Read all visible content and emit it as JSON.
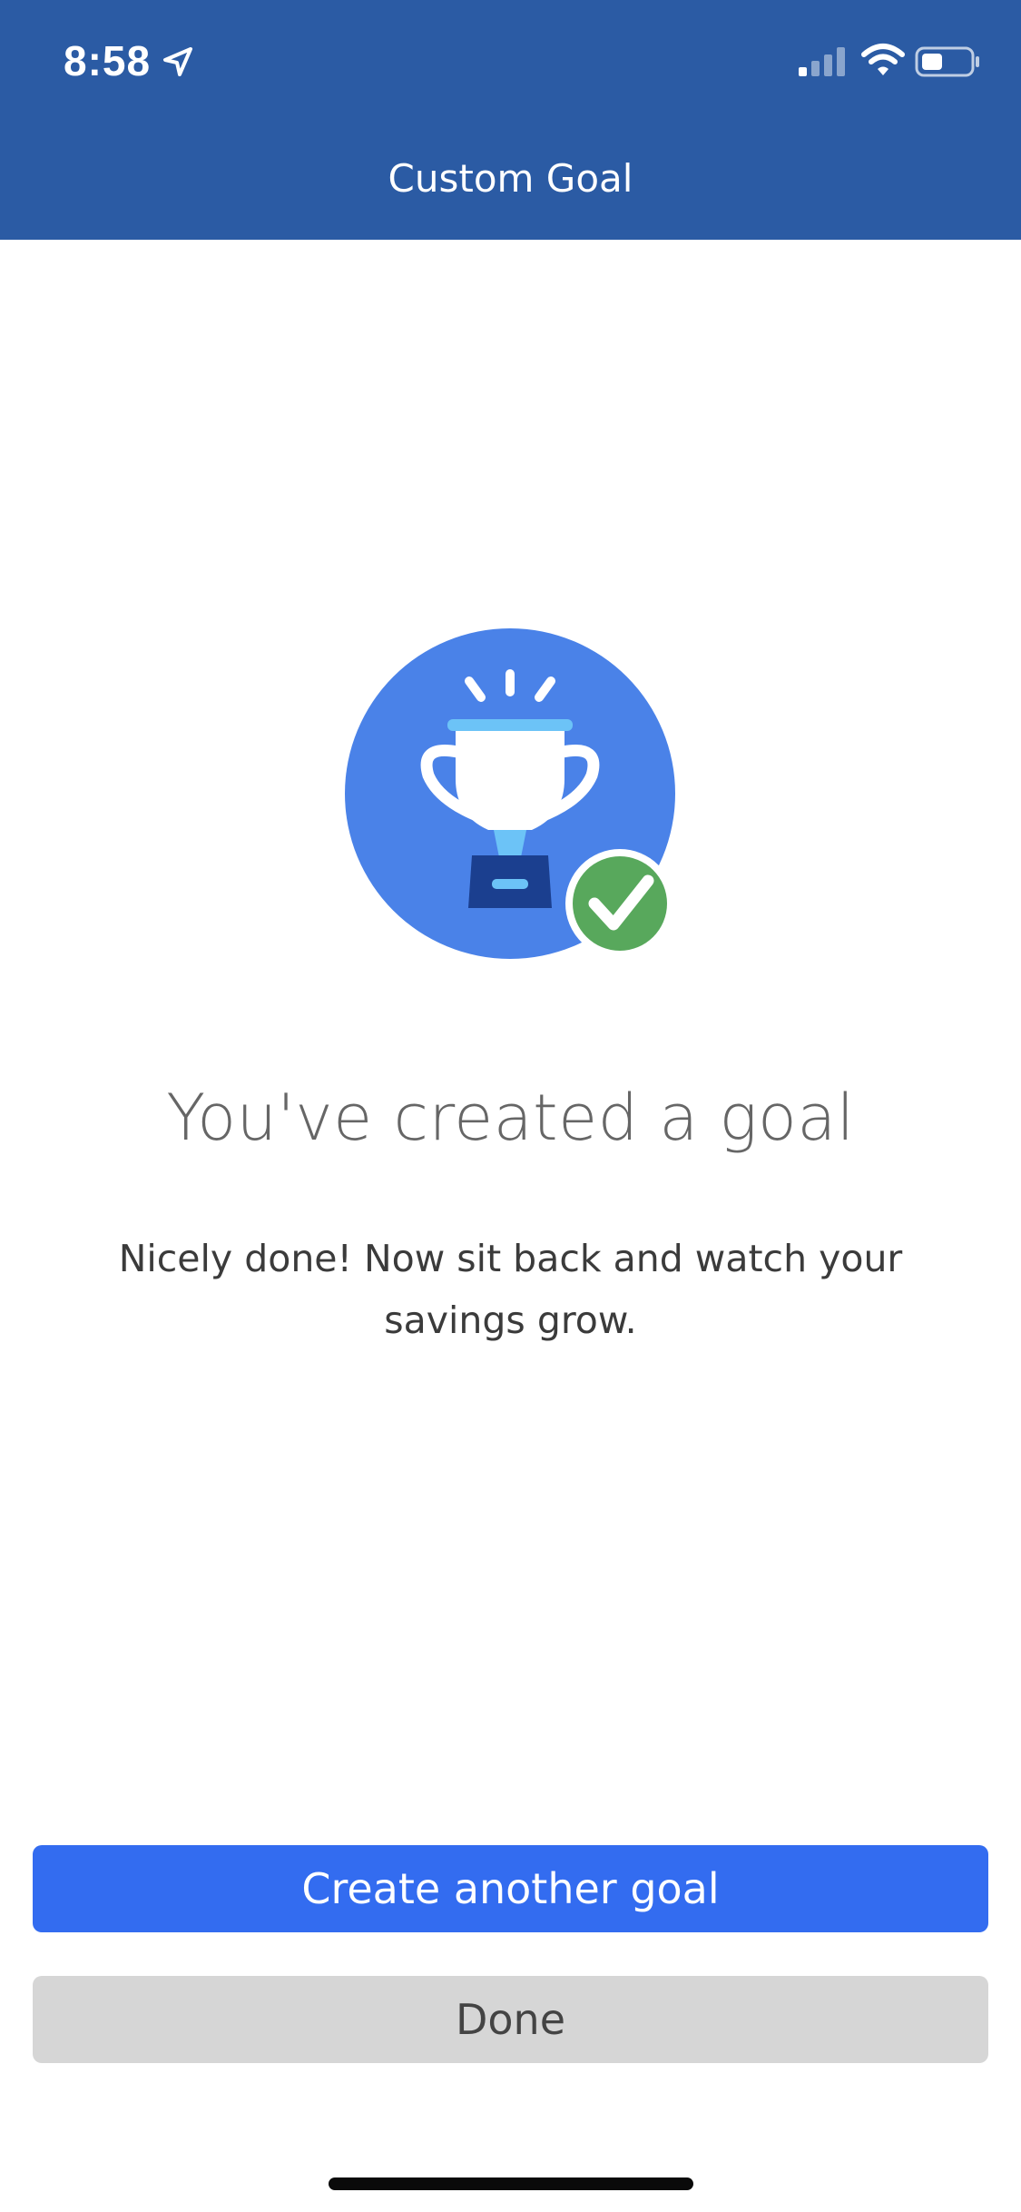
{
  "status_bar": {
    "time": "8:58"
  },
  "header": {
    "title": "Custom Goal"
  },
  "main": {
    "heading": "You've created a goal",
    "message": "Nicely done! Now sit back and watch your savings grow."
  },
  "actions": {
    "primary_label": "Create another goal",
    "secondary_label": "Done"
  },
  "icons": {
    "location": "location-arrow-icon",
    "signal": "cellular-signal-icon",
    "wifi": "wifi-icon",
    "battery": "battery-icon",
    "illustration": "trophy-icon",
    "check": "checkmark-icon"
  },
  "colors": {
    "header_bg": "#2b5ba4",
    "primary_button": "#336cf0",
    "secondary_button": "#d6d6d6",
    "illustration_circle": "#4a82e8",
    "check_badge": "#58a85c"
  }
}
